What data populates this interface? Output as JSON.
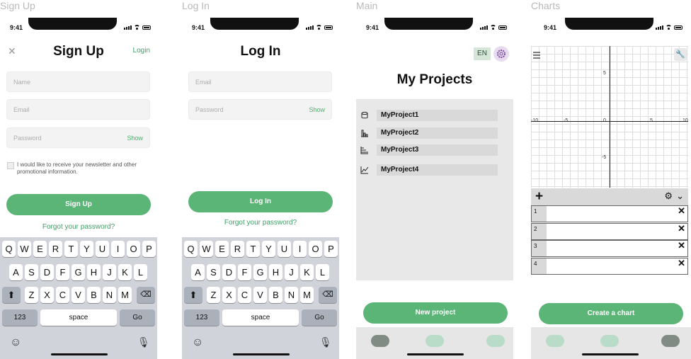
{
  "screens": {
    "signup": {
      "frame_title": "Sign Up",
      "time": "9:41",
      "close_icon": "close-icon",
      "title": "Sign Up",
      "login_link": "Login",
      "name_placeholder": "Name",
      "email_placeholder": "Email",
      "password_placeholder": "Password",
      "show_label": "Show",
      "newsletter_text": "I would like to receive your newsletter and other promotional information.",
      "button": "Sign Up",
      "forgot": "Forgot your password?"
    },
    "login": {
      "frame_title": "Log In",
      "time": "9:41",
      "title": "Log In",
      "email_placeholder": "Email",
      "password_placeholder": "Password",
      "show_label": "Show",
      "button": "Log In",
      "forgot": "Forgot your password?"
    },
    "main": {
      "frame_title": "Main",
      "time": "9:41",
      "lang": "EN",
      "title": "My Projects",
      "projects": [
        "MyProject1",
        "MyProject2",
        "MyProject3",
        "MyProject4"
      ],
      "project_icons": [
        "cylinder-icon",
        "bar-chart-icon",
        "horizontal-bar-chart-icon",
        "line-chart-icon"
      ],
      "button": "New project"
    },
    "charts": {
      "frame_title": "Charts",
      "time": "9:41",
      "ticks_x": [
        "-10",
        "-5",
        "0",
        "5",
        "10"
      ],
      "ticks_y": [
        "5",
        "-5"
      ],
      "rows": [
        "1",
        "2",
        "3",
        "4"
      ],
      "button": "Create a chart"
    }
  },
  "keyboard": {
    "row1": [
      "Q",
      "W",
      "E",
      "R",
      "T",
      "Y",
      "U",
      "I",
      "O",
      "P"
    ],
    "row2": [
      "A",
      "S",
      "D",
      "F",
      "G",
      "H",
      "J",
      "K",
      "L"
    ],
    "row3": [
      "Z",
      "X",
      "C",
      "V",
      "B",
      "N",
      "M"
    ],
    "numbers": "123",
    "space": "space",
    "go": "Go"
  },
  "colors": {
    "accent_green": "#5ab577",
    "link_green": "#3f9f66",
    "field_bg": "#f3f3f3",
    "keyboard_bg": "#d0d4da"
  }
}
